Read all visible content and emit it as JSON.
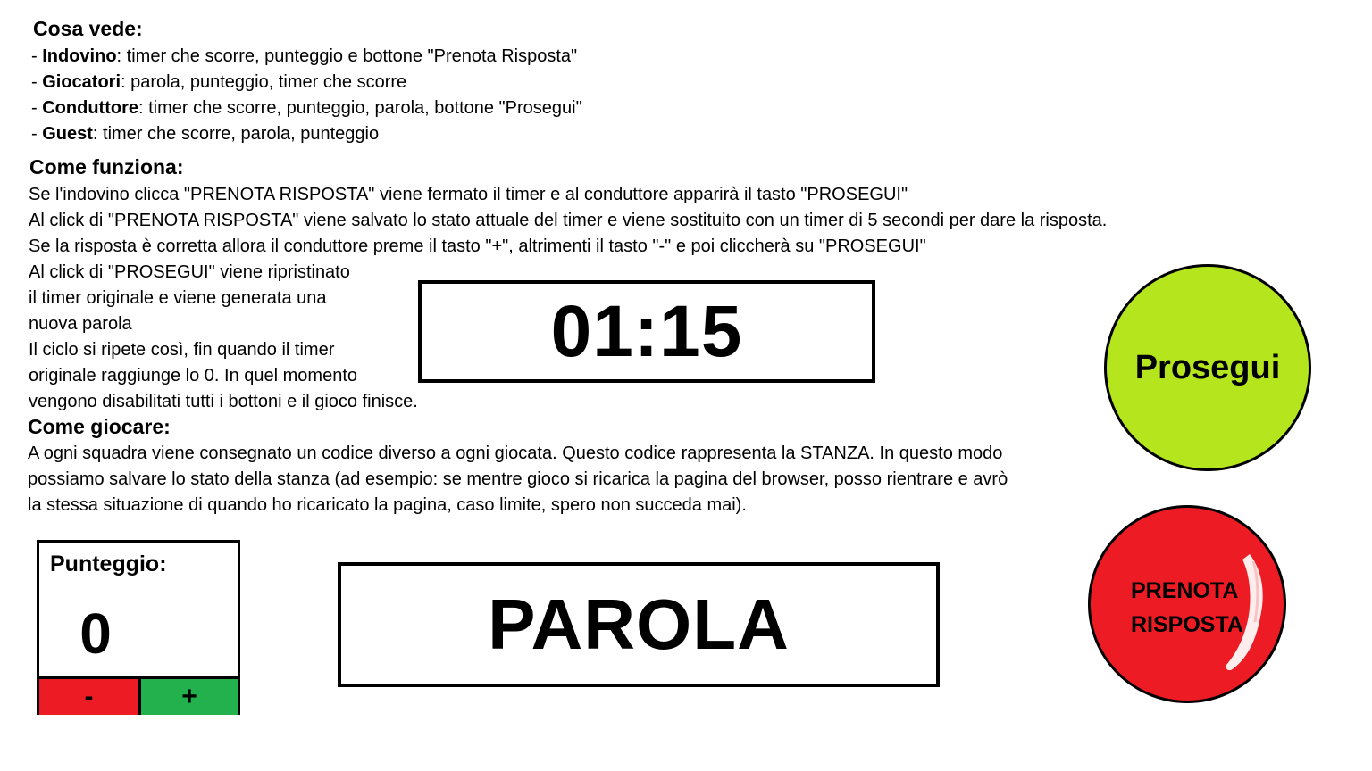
{
  "sections": {
    "cosa_vede": {
      "heading": "Cosa vede:",
      "items": [
        {
          "prefix": "- ",
          "role": "Indovino",
          "text": ": timer che scorre, punteggio e bottone \"Prenota Risposta\""
        },
        {
          "prefix": "- ",
          "role": "Giocatori",
          "text": ": parola, punteggio, timer che scorre"
        },
        {
          "prefix": "- ",
          "role": "Conduttore",
          "text": ": timer che scorre, punteggio, parola, bottone \"Prosegui\""
        },
        {
          "prefix": "- ",
          "role": "Guest",
          "text": ": timer che scorre, parola, punteggio"
        }
      ]
    },
    "come_funziona": {
      "heading": "Come funziona:",
      "lines": [
        "Se l'indovino clicca \"PRENOTA RISPOSTA\" viene fermato il timer e al conduttore apparirà il tasto \"PROSEGUI\"",
        "Al click di \"PRENOTA RISPOSTA\" viene salvato lo stato attuale del timer e viene sostituito con un timer di 5 secondi per dare la risposta.",
        "Se la risposta è corretta allora il conduttore preme il tasto \"+\", altrimenti il tasto \"-\" e poi cliccherà su \"PROSEGUI\"",
        "Al click di \"PROSEGUI\" viene ripristinato",
        "il timer originale e viene generata una",
        "nuova parola",
        "Il ciclo si ripete così, fin quando il timer",
        "originale raggiunge lo 0. In quel momento",
        "vengono disabilitati tutti i bottoni e il gioco finisce."
      ]
    },
    "come_giocare": {
      "heading": "Come giocare:",
      "lines": [
        "A ogni squadra viene consegnato un codice diverso a ogni giocata. Questo codice rappresenta la STANZA. In questo modo",
        "possiamo salvare lo stato della stanza (ad esempio: se mentre gioco si ricarica la pagina del browser, posso rientrare e avrò",
        "la stessa situazione di quando ho ricaricato la pagina, caso limite, spero non succeda mai)."
      ]
    }
  },
  "timer": {
    "value": "01:15"
  },
  "prosegui": {
    "label": "Prosegui",
    "color": "#b5e61d"
  },
  "prenota": {
    "line1": "PRENOTA",
    "line2": "RISPOSTA",
    "color": "#ed1c24"
  },
  "score": {
    "label": "Punteggio:",
    "value": "0",
    "minus_label": "-",
    "plus_label": "+",
    "minus_color": "#ed1c24",
    "plus_color": "#22b14c"
  },
  "word": {
    "value": "PAROLA"
  }
}
